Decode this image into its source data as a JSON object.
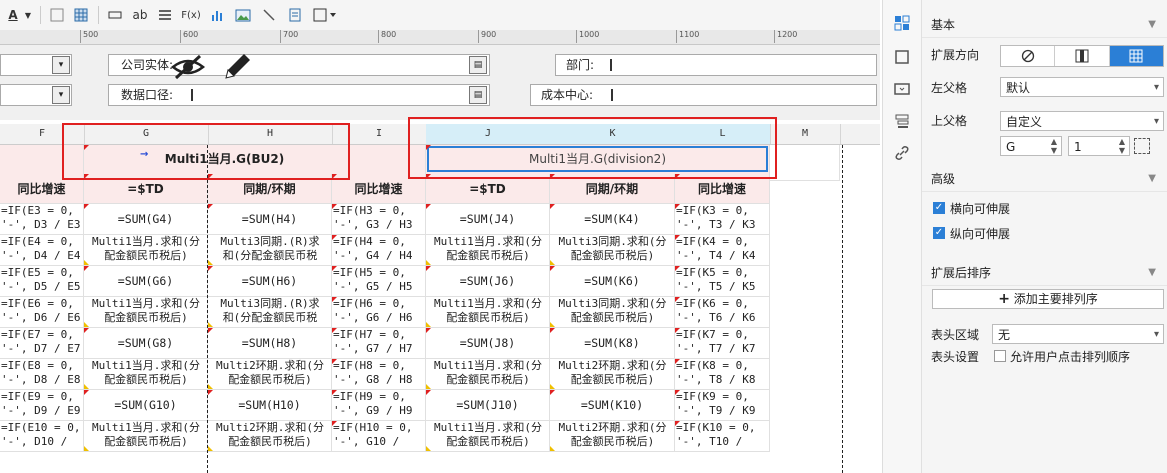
{
  "toolbar": {
    "font_color_icon": "A",
    "text_ab": "ab",
    "formula_icon": "F(x)"
  },
  "ruler": {
    "ticks": [
      "500",
      "600",
      "700",
      "800",
      "900",
      "1000",
      "1100",
      "1200"
    ]
  },
  "params": {
    "company_label": "公司实体:",
    "department_label": "部门:",
    "data_caliber_label": "数据口径:",
    "cost_center_label": "成本中心:"
  },
  "columns": [
    "F",
    "G",
    "H",
    "I",
    "J",
    "K",
    "L",
    "M"
  ],
  "grid": {
    "title_bu2": "Multi1当月.G(BU2)",
    "title_div2": "Multi1当月.G(division2)",
    "headers": [
      "同比增速",
      "=$TD",
      "同期/环期",
      "同比增速",
      "=$TD",
      "同期/环期",
      "同比增速"
    ],
    "rows": [
      [
        "=IF(E3 = 0,",
        "'-', D3 / E3",
        "=SUM(G4)",
        "=SUM(H4)",
        "=IF(H3 = 0,",
        "'-', G3 / H3",
        "=SUM(J4)",
        "=SUM(K4)",
        "=IF(K3 = 0,",
        "'-', T3 / K3"
      ],
      [
        "=IF(E4 = 0,",
        "'-', D4 / E4",
        "Multi1当月.求和(分",
        "Multi3同期.(R)求",
        "=IF(H4 = 0,",
        "'-', G4 / H4",
        "Multi1当月.求和(分",
        "Multi3同期.求和(分",
        "=IF(K4 = 0,",
        "'-', T4 / K4",
        "配金额民币税后)",
        "和(分配金额民币税",
        "配金额民币税后)",
        "配金额民币税后)"
      ],
      [
        "=IF(E5 = 0,",
        "'-', D5 / E5",
        "=SUM(G6)",
        "=SUM(H6)",
        "=IF(H5 = 0,",
        "'-', G5 / H5",
        "=SUM(J6)",
        "=SUM(K6)",
        "=IF(K5 = 0,",
        "'-', T5 / K5"
      ],
      [
        "=IF(E6 = 0,",
        "'-', D6 / E6",
        "Multi1当月.求和(分",
        "Multi3同期.(R)求",
        "=IF(H6 = 0,",
        "'-', G6 / H6",
        "Multi1当月.求和(分",
        "Multi3同期.求和(分",
        "=IF(K6 = 0,",
        "'-', T6 / K6",
        "配金额民币税后)",
        "和(分配金额民币税",
        "配金额民币税后)",
        "配金额民币税后)"
      ],
      [
        "=IF(E7 = 0,",
        "'-', D7 / E7",
        "=SUM(G8)",
        "=SUM(H8)",
        "=IF(H7 = 0,",
        "'-', G7 / H7",
        "=SUM(J8)",
        "=SUM(K8)",
        "=IF(K7 = 0,",
        "'-', T7 / K7"
      ],
      [
        "=IF(E8 = 0,",
        "'-', D8 / E8",
        "Multi1当月.求和(分",
        "Multi2环期.求和(分",
        "=IF(H8 = 0,",
        "'-', G8 / H8",
        "Multi1当月.求和(分",
        "Multi2环期.求和(分",
        "=IF(K8 = 0,",
        "'-', T8 / K8",
        "配金额民币税后)",
        "配金额民币税后)",
        "配金额民币税后)",
        "配金额民币税后)"
      ],
      [
        "=IF(E9 = 0,",
        "'-', D9 / E9",
        "=SUM(G10)",
        "=SUM(H10)",
        "=IF(H9 = 0,",
        "'-', G9 / H9",
        "=SUM(J10)",
        "=SUM(K10)",
        "=IF(K9 = 0,",
        "'-', T9 / K9"
      ],
      [
        "=IF(E10 = 0,",
        "'-', D10 /",
        "Multi1当月.求和(分",
        "Multi2环期.求和(分",
        "=IF(H10 = 0,",
        "'-', G10 /",
        "Multi1当月.求和(分",
        "Multi2环期.求和(分",
        "=IF(K10 = 0,",
        "'-', T10 /",
        "配金额民币税后)",
        "配金额民币税后)",
        "配金额民币税后)",
        "配金额民币税后)"
      ]
    ]
  },
  "panel": {
    "basic": "基本",
    "expand_direction": "扩展方向",
    "left_parent": "左父格",
    "left_parent_value": "默认",
    "upper_parent": "上父格",
    "upper_parent_value": "自定义",
    "upper_col": "G",
    "upper_row": "1",
    "advanced": "高级",
    "h_expand": "横向可伸展",
    "v_expand": "纵向可伸展",
    "sort_after": "扩展后排序",
    "add_sort": "添加主要排列序",
    "header_area": "表头区域",
    "header_area_value": "无",
    "header_setting": "表头设置",
    "allow_sort": "允许用户点击排列顺序"
  },
  "colors": {
    "accent": "#2b7fd6",
    "highlight": "#e02020",
    "sel_col": "#d6eef8"
  }
}
